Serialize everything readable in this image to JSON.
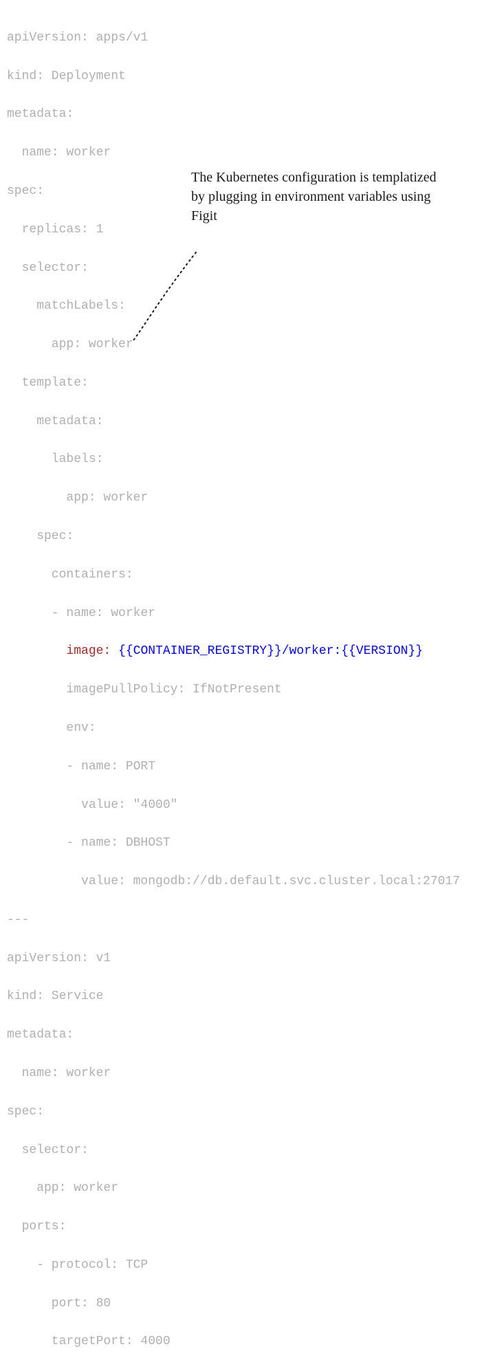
{
  "annotation": {
    "text": "The Kubernetes configuration is templatized by plugging in environment variables using Figit"
  },
  "yaml": {
    "l0": "apiVersion: apps/v1",
    "l1": "kind: Deployment",
    "l2": "metadata:",
    "l3": "  name: worker",
    "l4": "spec:",
    "l5": "  replicas: 1",
    "l6": "  selector:",
    "l7": "    matchLabels:",
    "l8": "      app: worker",
    "l9": "  template:",
    "l10": "    metadata:",
    "l11": "      labels:",
    "l12": "        app: worker",
    "l13": "    spec:",
    "l14": "      containers:",
    "l15": "      - name: worker",
    "highlighted": {
      "indent": "        ",
      "key": "image:",
      "space": " ",
      "open1": "{{",
      "var1": "CONTAINER_REGISTRY",
      "close1": "}}",
      "slash": "/worker:",
      "open2": "{{",
      "var2": "VERSION",
      "close2": "}}"
    },
    "l17": "        imagePullPolicy: IfNotPresent",
    "l18": "        env:",
    "l19": "        - name: PORT",
    "l20": "          value: \"4000\"",
    "l21": "        - name: DBHOST",
    "l22": "          value: mongodb://db.default.svc.cluster.local:27017",
    "l23": "---",
    "l24": "apiVersion: v1",
    "l25": "kind: Service",
    "l26": "metadata:",
    "l27": "  name: worker",
    "l28": "spec:",
    "l29": "  selector:",
    "l30": "    app: worker",
    "l31": "  ports:",
    "l32": "    - protocol: TCP",
    "l33": "      port: 80",
    "l34": "      targetPort: 4000"
  }
}
